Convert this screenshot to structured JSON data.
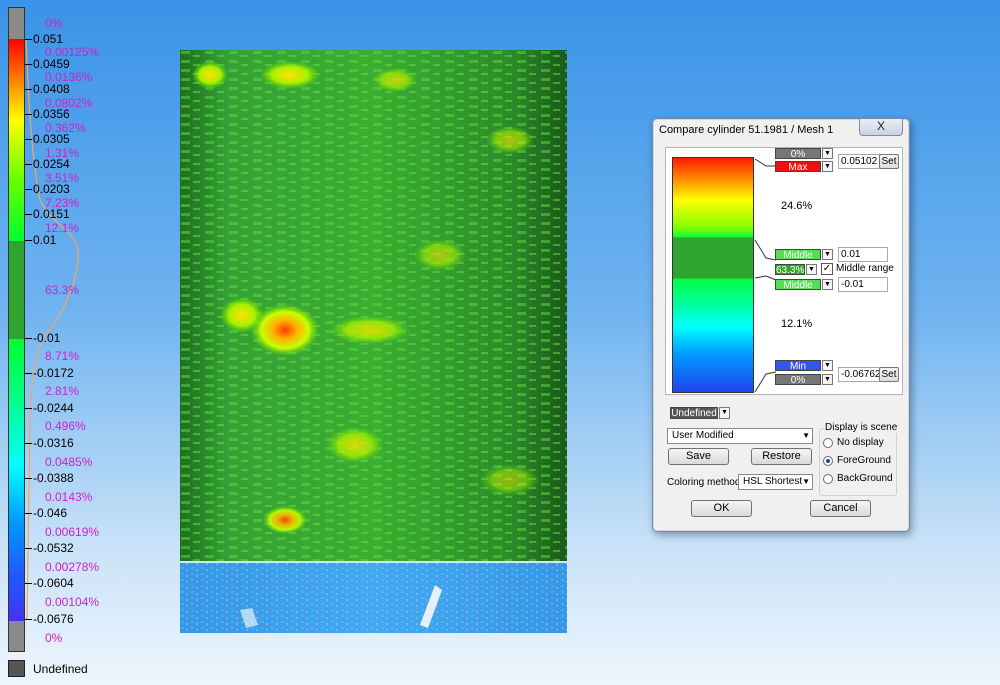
{
  "scale": {
    "values": [
      "0.051",
      "0.0459",
      "0.0408",
      "0.0356",
      "0.0305",
      "0.0254",
      "0.0203",
      "0.0151",
      "0.01",
      "-0.01",
      "-0.0172",
      "-0.0244",
      "-0.0316",
      "-0.0388",
      "-0.046",
      "-0.0532",
      "-0.0604",
      "-0.0676"
    ],
    "percents": [
      "0%",
      "0.00125%",
      "0.0136%",
      "0.0802%",
      "0.362%",
      "1.31%",
      "3.51%",
      "7.23%",
      "12.1%",
      "63.3%",
      "8.71%",
      "2.81%",
      "0.496%",
      "0.0485%",
      "0.0143%",
      "0.00619%",
      "0.00278%",
      "0.00104%",
      "0%"
    ],
    "undefined_label": "Undefined",
    "colors": {
      "out_of_range": "#8a8a8a",
      "middle": "#2fa52f",
      "distribution_curve": "#f0a860",
      "percent_text": "#cc22cc"
    }
  },
  "dialog": {
    "title": "Compare cylinder 51.1981 / Mesh 1",
    "close_label": "X",
    "top_pct_label": "0%",
    "max_label": "Max",
    "max_value": "0.05102",
    "set_label": "Set",
    "upper_pct": "24.6%",
    "middle_max_label": "Middle max",
    "middle_max_value": "0.01",
    "middle_pct": "63.3%",
    "middle_range_label": "Middle range",
    "middle_min_label": "Middle min",
    "middle_min_value": "-0.01",
    "lower_pct": "12.1%",
    "min_label": "Min",
    "min_value": "-0.06762",
    "bottom_pct_label": "0%",
    "undefined_label": "Undefined",
    "preset_value": "User Modified",
    "save_label": "Save",
    "restore_label": "Restore",
    "coloring_method_label": "Coloring method",
    "coloring_method_value": "HSL Shortest",
    "display_group_label": "Display is scene",
    "radio_no_display": "No display",
    "radio_foreground": "ForeGround",
    "radio_background": "BackGround",
    "selected_display": "ForeGround",
    "ok_label": "OK",
    "cancel_label": "Cancel",
    "colors": {
      "max": "#ee1111",
      "min": "#3355ee",
      "middle": "#55dd55",
      "out_of_range": "#777777"
    }
  }
}
